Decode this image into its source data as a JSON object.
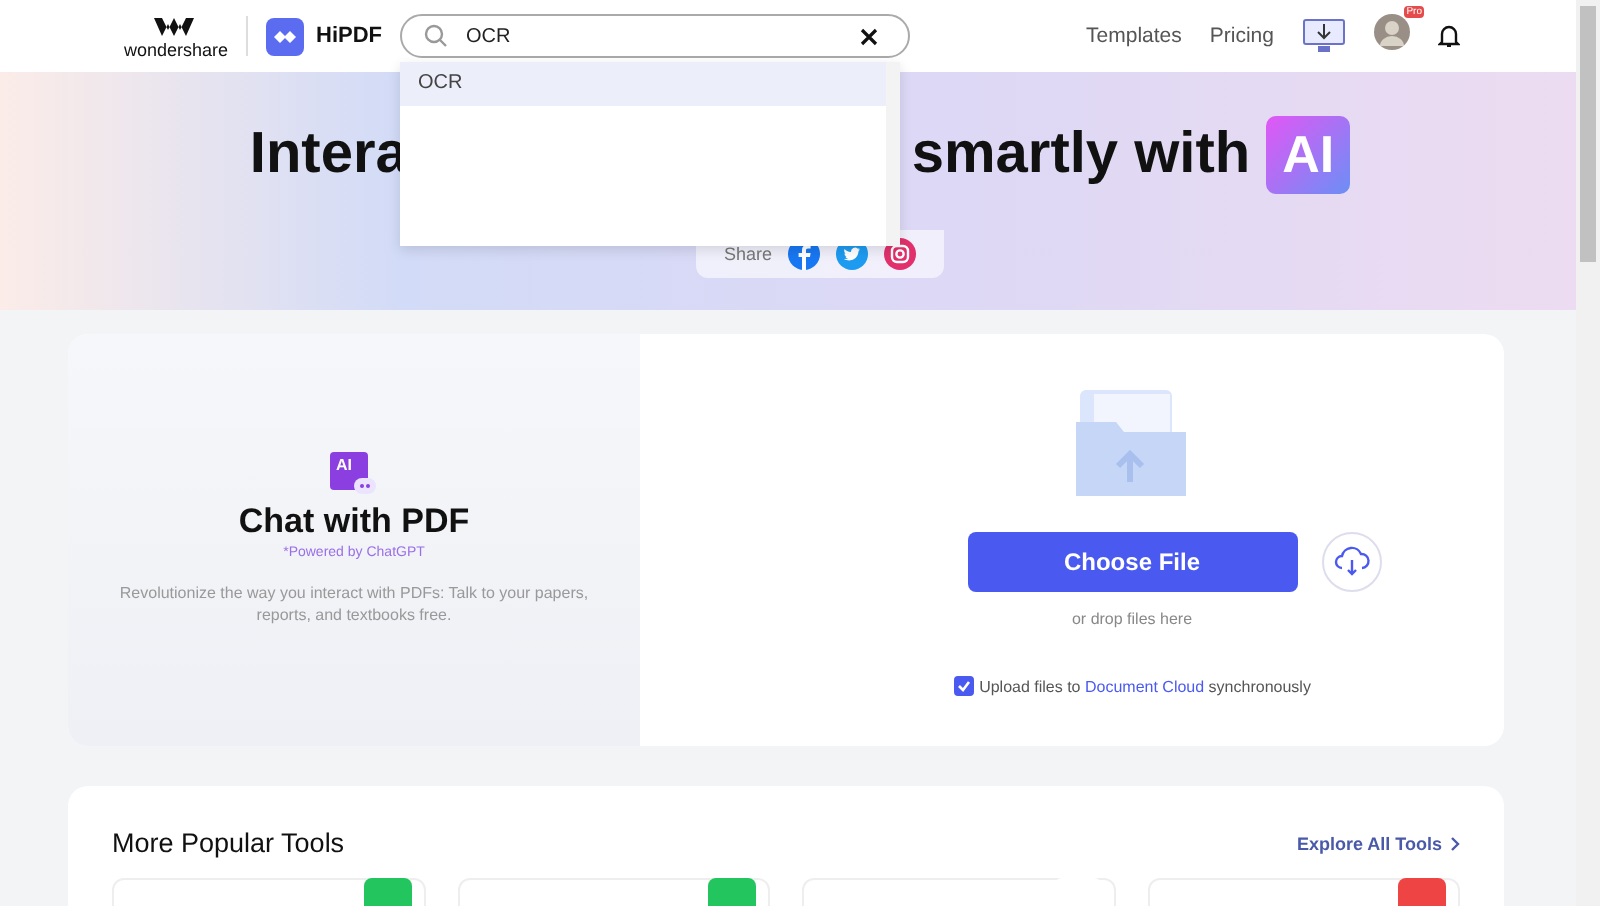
{
  "header": {
    "brand": "wondershare",
    "product": "HiPDF",
    "search": {
      "value": "OCR"
    },
    "nav": [
      "Templates",
      "Pricing"
    ],
    "avatar_badge": "Pro"
  },
  "suggestions": [
    {
      "label": "OCR",
      "selected": true
    }
  ],
  "hero": {
    "title_left": "Intera",
    "title_right": "smartly with",
    "title_badge": "AI",
    "share_label": "Share"
  },
  "chat": {
    "badge": "AI",
    "title": "Chat with PDF",
    "powered": "*Powered by ChatGPT",
    "description": "Revolutionize the way you interact with PDFs: Talk to your papers, reports, and textbooks free."
  },
  "upload": {
    "button": "Choose File",
    "hint": "or drop files here",
    "sync": {
      "checked": true,
      "before": "Upload files to",
      "link": "Document Cloud",
      "after": "synchronously"
    }
  },
  "tools": {
    "title": "More Popular Tools",
    "explore": "Explore All Tools",
    "cards": [
      {
        "color": "#22c55e"
      },
      {
        "color": "#22c55e"
      },
      {
        "color": "#ffffff"
      },
      {
        "color": "#ef4444"
      }
    ]
  }
}
